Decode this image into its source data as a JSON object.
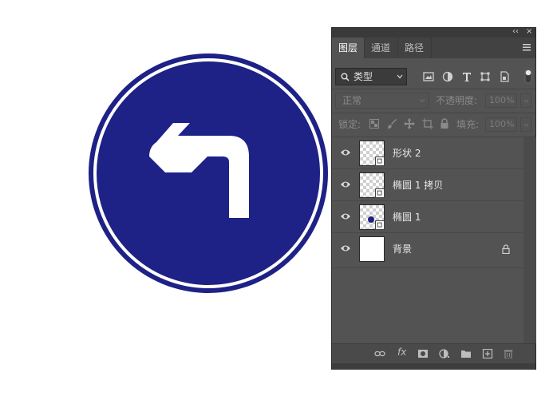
{
  "panel": {
    "tabs": [
      {
        "label": "图层",
        "active": true
      },
      {
        "label": "通道",
        "active": false
      },
      {
        "label": "路径",
        "active": false
      }
    ],
    "collapse_glyph": "‹‹",
    "close_glyph": "×",
    "filter": {
      "value": "类型"
    },
    "blend_mode": {
      "value": "正常"
    },
    "opacity": {
      "label": "不透明度:",
      "value": "100%"
    },
    "lock": {
      "label": "锁定:"
    },
    "fill": {
      "label": "填充:",
      "value": "100%"
    },
    "layers": [
      {
        "name": "形状 2",
        "thumb": "shape",
        "visible": true
      },
      {
        "name": "椭圆 1 拷贝",
        "thumb": "shape",
        "visible": true
      },
      {
        "name": "椭圆 1",
        "thumb": "shape-dot",
        "visible": true
      },
      {
        "name": "背景",
        "thumb": "white",
        "visible": true,
        "locked": true
      }
    ],
    "footer_fx": "fx"
  },
  "colors": {
    "sign_blue": "#1e2185",
    "panel_bg": "#535353",
    "sign_white": "#ffffff"
  },
  "icons": [
    "search-icon",
    "chevron-down-icon",
    "image-filter-icon",
    "adjustment-filter-icon",
    "type-filter-icon",
    "shape-filter-icon",
    "smart-object-filter-icon",
    "filter-toggle-icon",
    "lock-pixels-icon",
    "brush-icon",
    "move-icon",
    "artboard-icon",
    "lock-icon",
    "eye-icon",
    "link-icon",
    "fx-icon",
    "mask-icon",
    "adjustment-layer-icon",
    "folder-icon",
    "new-layer-icon",
    "trash-icon",
    "panel-menu-icon"
  ]
}
